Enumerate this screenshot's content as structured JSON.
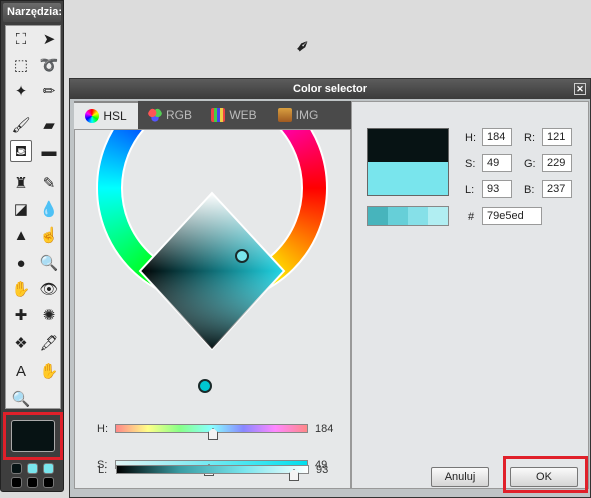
{
  "tools_panel": {
    "title": "Narzędzia:",
    "tools": [
      {
        "name": "crop-icon",
        "glyph": "⛶"
      },
      {
        "name": "move-icon",
        "glyph": "➤"
      },
      {
        "name": "marquee-icon",
        "glyph": "⬚"
      },
      {
        "name": "lasso-icon",
        "glyph": "➰"
      },
      {
        "name": "magic-wand-icon",
        "glyph": "✦"
      },
      {
        "name": "pencil-icon",
        "glyph": "✏"
      },
      {
        "name": "brush-icon",
        "glyph": "🖌"
      },
      {
        "name": "eraser-icon",
        "glyph": "▰"
      },
      {
        "name": "bucket-icon",
        "glyph": "⛾"
      },
      {
        "name": "gradient-icon",
        "glyph": "▬"
      },
      {
        "name": "stamp-icon",
        "glyph": "♜"
      },
      {
        "name": "color-replace-icon",
        "glyph": "✎"
      },
      {
        "name": "shape-icon",
        "glyph": "◪"
      },
      {
        "name": "blur-icon",
        "glyph": "💧"
      },
      {
        "name": "sharpen-icon",
        "glyph": "▲"
      },
      {
        "name": "smudge-icon",
        "glyph": "☝"
      },
      {
        "name": "sponge-icon",
        "glyph": "●"
      },
      {
        "name": "burn-icon",
        "glyph": "🔍"
      },
      {
        "name": "dodge-icon",
        "glyph": "✋"
      },
      {
        "name": "red-eye-icon",
        "glyph": "👁"
      },
      {
        "name": "spot-heal-icon",
        "glyph": "✚"
      },
      {
        "name": "bloat-icon",
        "glyph": "✺"
      },
      {
        "name": "pinch-icon",
        "glyph": "❖"
      },
      {
        "name": "eyedropper-icon",
        "glyph": "🖋"
      },
      {
        "name": "text-icon",
        "glyph": "A"
      },
      {
        "name": "hand-icon",
        "glyph": "✋"
      },
      {
        "name": "zoom-icon",
        "glyph": "🔍"
      }
    ]
  },
  "dialog": {
    "title": "Color selector",
    "close_glyph": "✕",
    "tabs": [
      {
        "label": "HSL"
      },
      {
        "label": "RGB"
      },
      {
        "label": "WEB"
      },
      {
        "label": "IMG"
      }
    ],
    "sliders": [
      {
        "label": "H:",
        "value": "184",
        "fraction": 0.51
      },
      {
        "label": "S:",
        "value": "49",
        "fraction": 0.49
      },
      {
        "label": "L:",
        "value": "93",
        "fraction": 0.93
      }
    ],
    "fields": {
      "h_label": "H:",
      "h": "184",
      "s_label": "S:",
      "s": "49",
      "l_label": "L:",
      "l": "93",
      "r_label": "R:",
      "r": "121",
      "g_label": "G:",
      "g": "229",
      "b_label": "B:",
      "b": "237",
      "hex_label": "#",
      "hex": "79e5ed"
    },
    "buttons": {
      "cancel": "Anuluj",
      "ok": "OK"
    }
  },
  "colors": {
    "old_color": "#071314",
    "new_color": "#79e5ed",
    "highlight": "#e0202a"
  }
}
